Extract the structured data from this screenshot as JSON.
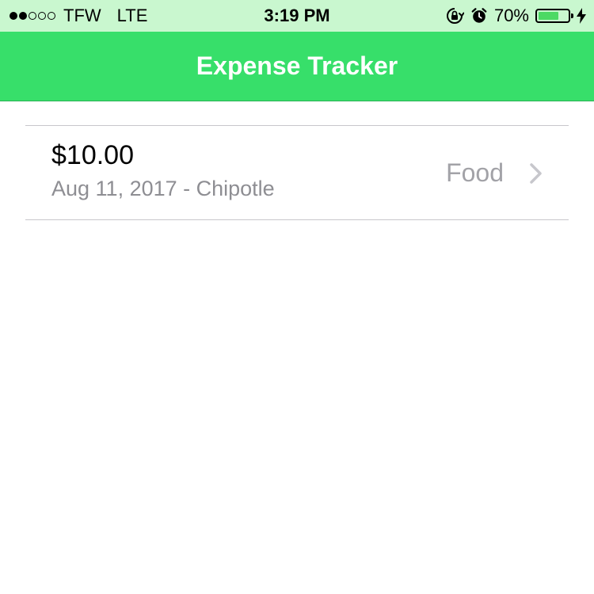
{
  "status_bar": {
    "signal_bars_filled": 2,
    "signal_bars_total": 5,
    "carrier": "TFW",
    "network": "LTE",
    "time": "3:19 PM",
    "battery_percent": "70%",
    "battery_level": 0.7,
    "icons": [
      "rotation-lock-icon",
      "alarm-icon",
      "battery-icon",
      "charging-bolt-icon"
    ]
  },
  "nav": {
    "title": "Expense Tracker"
  },
  "expenses": [
    {
      "amount": "$10.00",
      "subtitle": "Aug 11, 2017 - Chipotle",
      "category": "Food"
    }
  ],
  "colors": {
    "nav_background": "#37df6a",
    "status_background": "#c9f7cf",
    "secondary_text": "#8e8e93",
    "battery_fill": "#4cd964"
  }
}
